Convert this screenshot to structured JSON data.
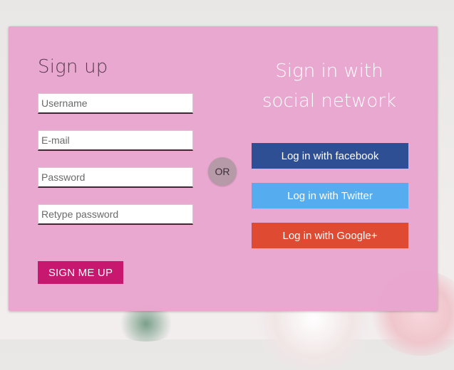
{
  "signup": {
    "title": "Sign up",
    "username_placeholder": "Username",
    "email_placeholder": "E-mail",
    "password_placeholder": "Password",
    "retype_placeholder": "Retype password",
    "submit_label": "SIGN ME UP"
  },
  "divider": {
    "label": "OR"
  },
  "social": {
    "title": "Sign in with social network",
    "facebook_label": "Log in with facebook",
    "twitter_label": "Log in with Twitter",
    "google_label": "Log in with Google+"
  },
  "colors": {
    "card": "#e8a5ce",
    "signup_button": "#c7176f",
    "facebook": "#2f4f94",
    "twitter": "#55acee",
    "google": "#df4a32"
  }
}
